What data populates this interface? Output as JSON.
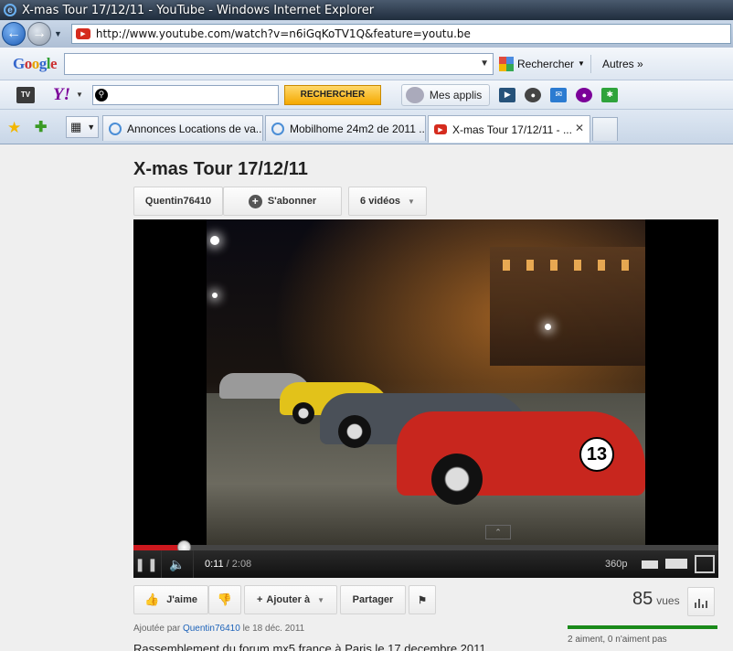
{
  "window": {
    "title": "X-mas Tour 17/12/11 - YouTube - Windows Internet Explorer"
  },
  "address": {
    "url": "http://www.youtube.com/watch?v=n6iGqKoTV1Q&feature=youtu.be"
  },
  "google_toolbar": {
    "logo": "Google",
    "search_value": "",
    "rechercher": "Rechercher",
    "autres": "Autres »"
  },
  "yahoo_toolbar": {
    "tv_label": "TV",
    "logo": "Y!",
    "search_value": "",
    "rechercher": "RECHERCHER",
    "mes_applis": "Mes applis"
  },
  "tabs": [
    {
      "label": "Annonces Locations de va..."
    },
    {
      "label": "Mobilhome 24m2 de 2011 ..."
    },
    {
      "label": "X-mas Tour 17/12/11 - ..."
    }
  ],
  "video": {
    "title": "X-mas Tour 17/12/11",
    "channel": "Quentin76410",
    "subscribe": "S'abonner",
    "videos_count": "6 vidéos",
    "car_number": "13",
    "progress_fraction": 0.088,
    "current_time": "0:11",
    "duration": "/ 2:08",
    "quality": "360p"
  },
  "actions": {
    "like": "J'aime",
    "add_to": "Ajouter à",
    "share": "Partager"
  },
  "stats": {
    "views": "85",
    "views_label": "vues",
    "likes_text": "2 aiment, 0 n'aiment pas"
  },
  "meta": {
    "added_prefix": "Ajoutée par",
    "added_user": "Quentin76410",
    "added_date": "le 18 déc. 2011",
    "description": "Rassemblement du forum mx5 france à Paris le 17 decembre 2011"
  },
  "colors": {
    "progress": "#cc181e",
    "like_bar": "#1a8a1a",
    "title_bar": "#1f2d3d"
  }
}
